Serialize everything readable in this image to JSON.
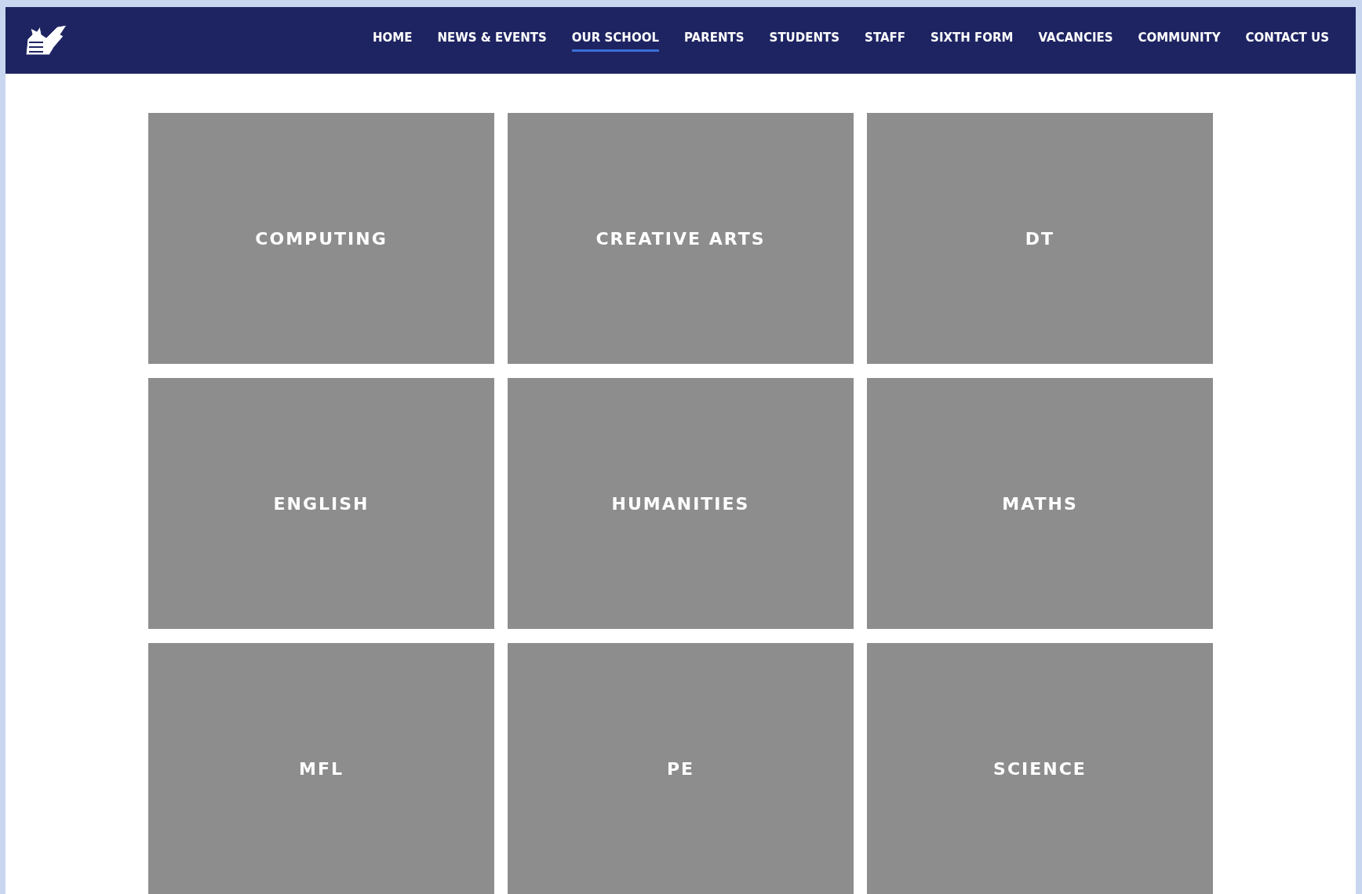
{
  "nav": {
    "items": [
      {
        "label": "HOME",
        "selected": false
      },
      {
        "label": "NEWS & EVENTS",
        "selected": false
      },
      {
        "label": "OUR SCHOOL",
        "selected": true
      },
      {
        "label": "PARENTS",
        "selected": false
      },
      {
        "label": "STUDENTS",
        "selected": false
      },
      {
        "label": "STAFF",
        "selected": false
      },
      {
        "label": "SIXTH FORM",
        "selected": false
      },
      {
        "label": "VACANCIES",
        "selected": false
      },
      {
        "label": "COMMUNITY",
        "selected": false
      },
      {
        "label": "CONTACT US",
        "selected": false
      }
    ]
  },
  "tiles": [
    {
      "label": "COMPUTING"
    },
    {
      "label": "CREATIVE ARTS"
    },
    {
      "label": "DT"
    },
    {
      "label": "ENGLISH"
    },
    {
      "label": "HUMANITIES"
    },
    {
      "label": "MATHS"
    },
    {
      "label": "MFL"
    },
    {
      "label": "PE"
    },
    {
      "label": "SCIENCE"
    }
  ]
}
